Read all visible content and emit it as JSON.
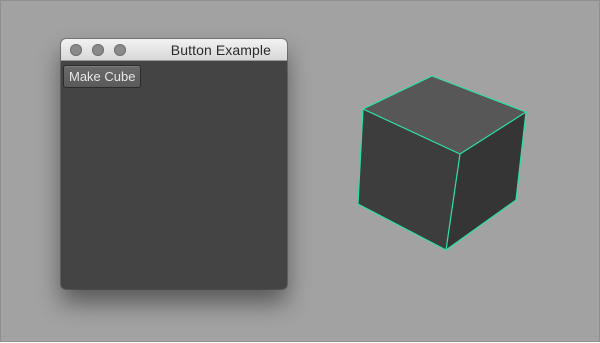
{
  "window": {
    "title": "Button Example",
    "make_cube_label": "Make Cube"
  },
  "scene": {
    "object": "cube",
    "selected": true,
    "highlight_color": "#2fe0a3"
  },
  "colors": {
    "viewport_background": "#a2a2a2",
    "window_background": "#444444",
    "cube_top": "#575757",
    "cube_left": "#3d3d3d",
    "cube_right": "#353535"
  }
}
